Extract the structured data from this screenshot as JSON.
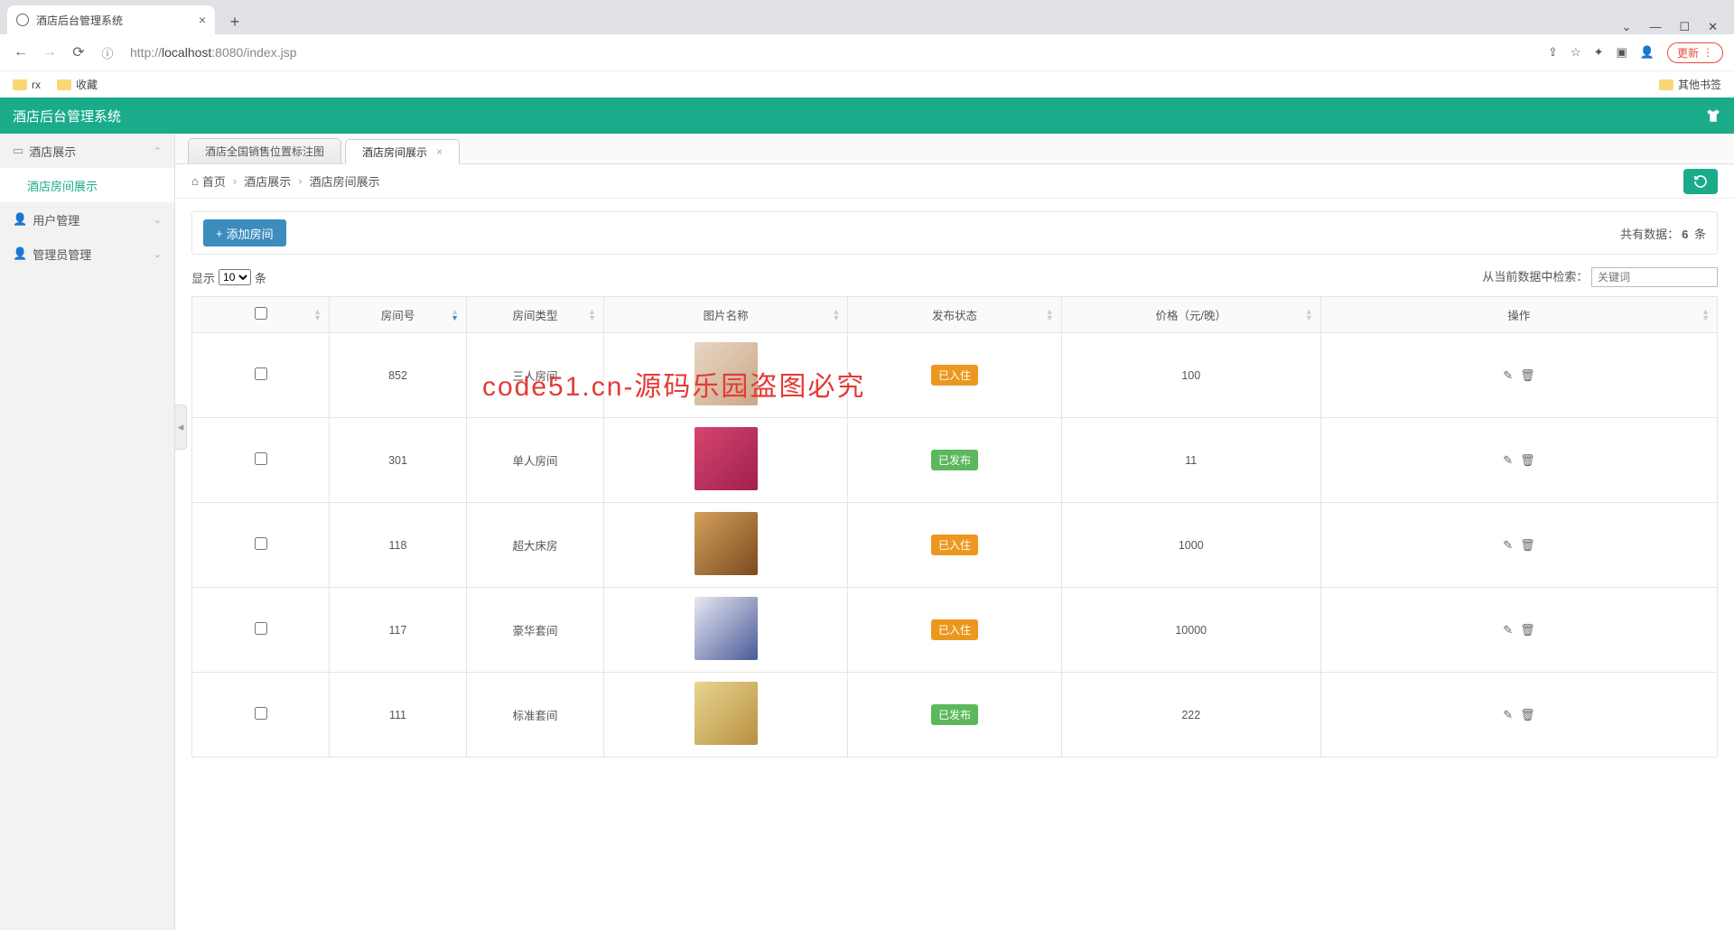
{
  "browser": {
    "tab_title": "酒店后台管理系统",
    "url_prefix": "http://",
    "url_host": "localhost",
    "url_port_path": ":8080/index.jsp",
    "update_label": "更新",
    "bookmarks": {
      "rx": "rx",
      "fav": "收藏",
      "other": "其他书签"
    }
  },
  "header": {
    "title": "酒店后台管理系统"
  },
  "sidebar": {
    "items": [
      {
        "label": "酒店展示",
        "hasChildren": true,
        "expanded": true,
        "icon": "image"
      },
      {
        "label": "酒店房间展示",
        "sub": true,
        "active": true
      },
      {
        "label": "用户管理",
        "hasChildren": true,
        "expanded": false,
        "icon": "user"
      },
      {
        "label": "管理员管理",
        "hasChildren": true,
        "expanded": false,
        "icon": "user"
      }
    ]
  },
  "tabs": [
    {
      "label": "酒店全国销售位置标注图",
      "active": false,
      "closable": false
    },
    {
      "label": "酒店房间展示",
      "active": true,
      "closable": true
    }
  ],
  "breadcrumb": {
    "home": "首页",
    "p1": "酒店展示",
    "p2": "酒店房间展示"
  },
  "toolbar": {
    "add_label": "添加房间",
    "total_prefix": "共有数据：",
    "total_count": "6",
    "total_suffix": " 条"
  },
  "length": {
    "show": "显示",
    "unit": "条",
    "selected": "10",
    "search_label": "从当前数据中检索：",
    "search_placeholder": "关键词"
  },
  "table": {
    "columns": [
      "",
      "房间号",
      "房间类型",
      "图片名称",
      "发布状态",
      "价格（元/晚）",
      "操作"
    ],
    "rows": [
      {
        "room": "852",
        "type": "三人房间",
        "status": "已入住",
        "statusColor": "orange",
        "price": "100"
      },
      {
        "room": "301",
        "type": "单人房间",
        "status": "已发布",
        "statusColor": "green",
        "price": "11"
      },
      {
        "room": "118",
        "type": "超大床房",
        "status": "已入住",
        "statusColor": "orange",
        "price": "1000"
      },
      {
        "room": "117",
        "type": "豪华套间",
        "status": "已入住",
        "statusColor": "orange",
        "price": "10000"
      },
      {
        "room": "111",
        "type": "标准套间",
        "status": "已发布",
        "statusColor": "green",
        "price": "222"
      }
    ]
  },
  "watermark": "code51.cn-源码乐园盗图必究"
}
